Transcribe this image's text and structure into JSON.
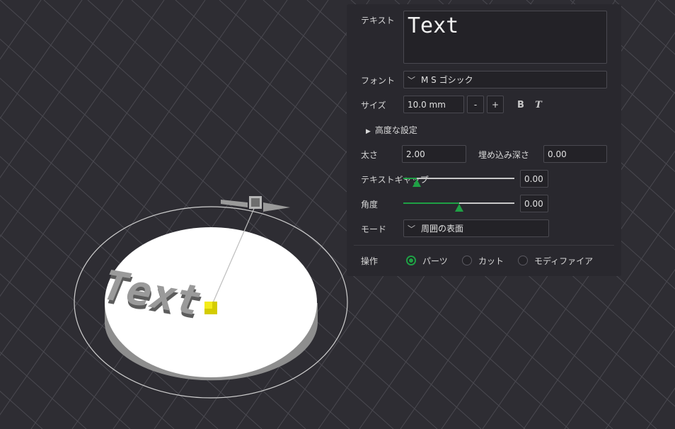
{
  "panel": {
    "text_label": "テキスト",
    "text_value": "Text",
    "font_label": "フォント",
    "font_value": "M S ゴシック",
    "size_label": "サイズ",
    "size_value": "10.0 mm",
    "size_minus": "-",
    "size_plus": "+",
    "bold_label": "B",
    "italic_label": "T",
    "advanced_label": "高度な設定",
    "thickness_label": "太さ",
    "thickness_value": "2.00",
    "emboss_depth_label": "埋め込み深さ",
    "emboss_depth_value": "0.00",
    "text_gap_label": "テキストギャップ",
    "text_gap_value": "0.00",
    "text_gap_level": 0.12,
    "angle_label": "角度",
    "angle_value": "0.00",
    "angle_level": 0.5,
    "mode_label": "モード",
    "mode_value": "周囲の表面",
    "operation_label": "操作",
    "operations": [
      {
        "label": "パーツ",
        "selected": true
      },
      {
        "label": "カット",
        "selected": false
      },
      {
        "label": "モディファイア",
        "selected": false
      }
    ]
  },
  "scene": {
    "object_text": "Text",
    "accent_color": "#1fa045",
    "handle_color": "#e8e000"
  }
}
